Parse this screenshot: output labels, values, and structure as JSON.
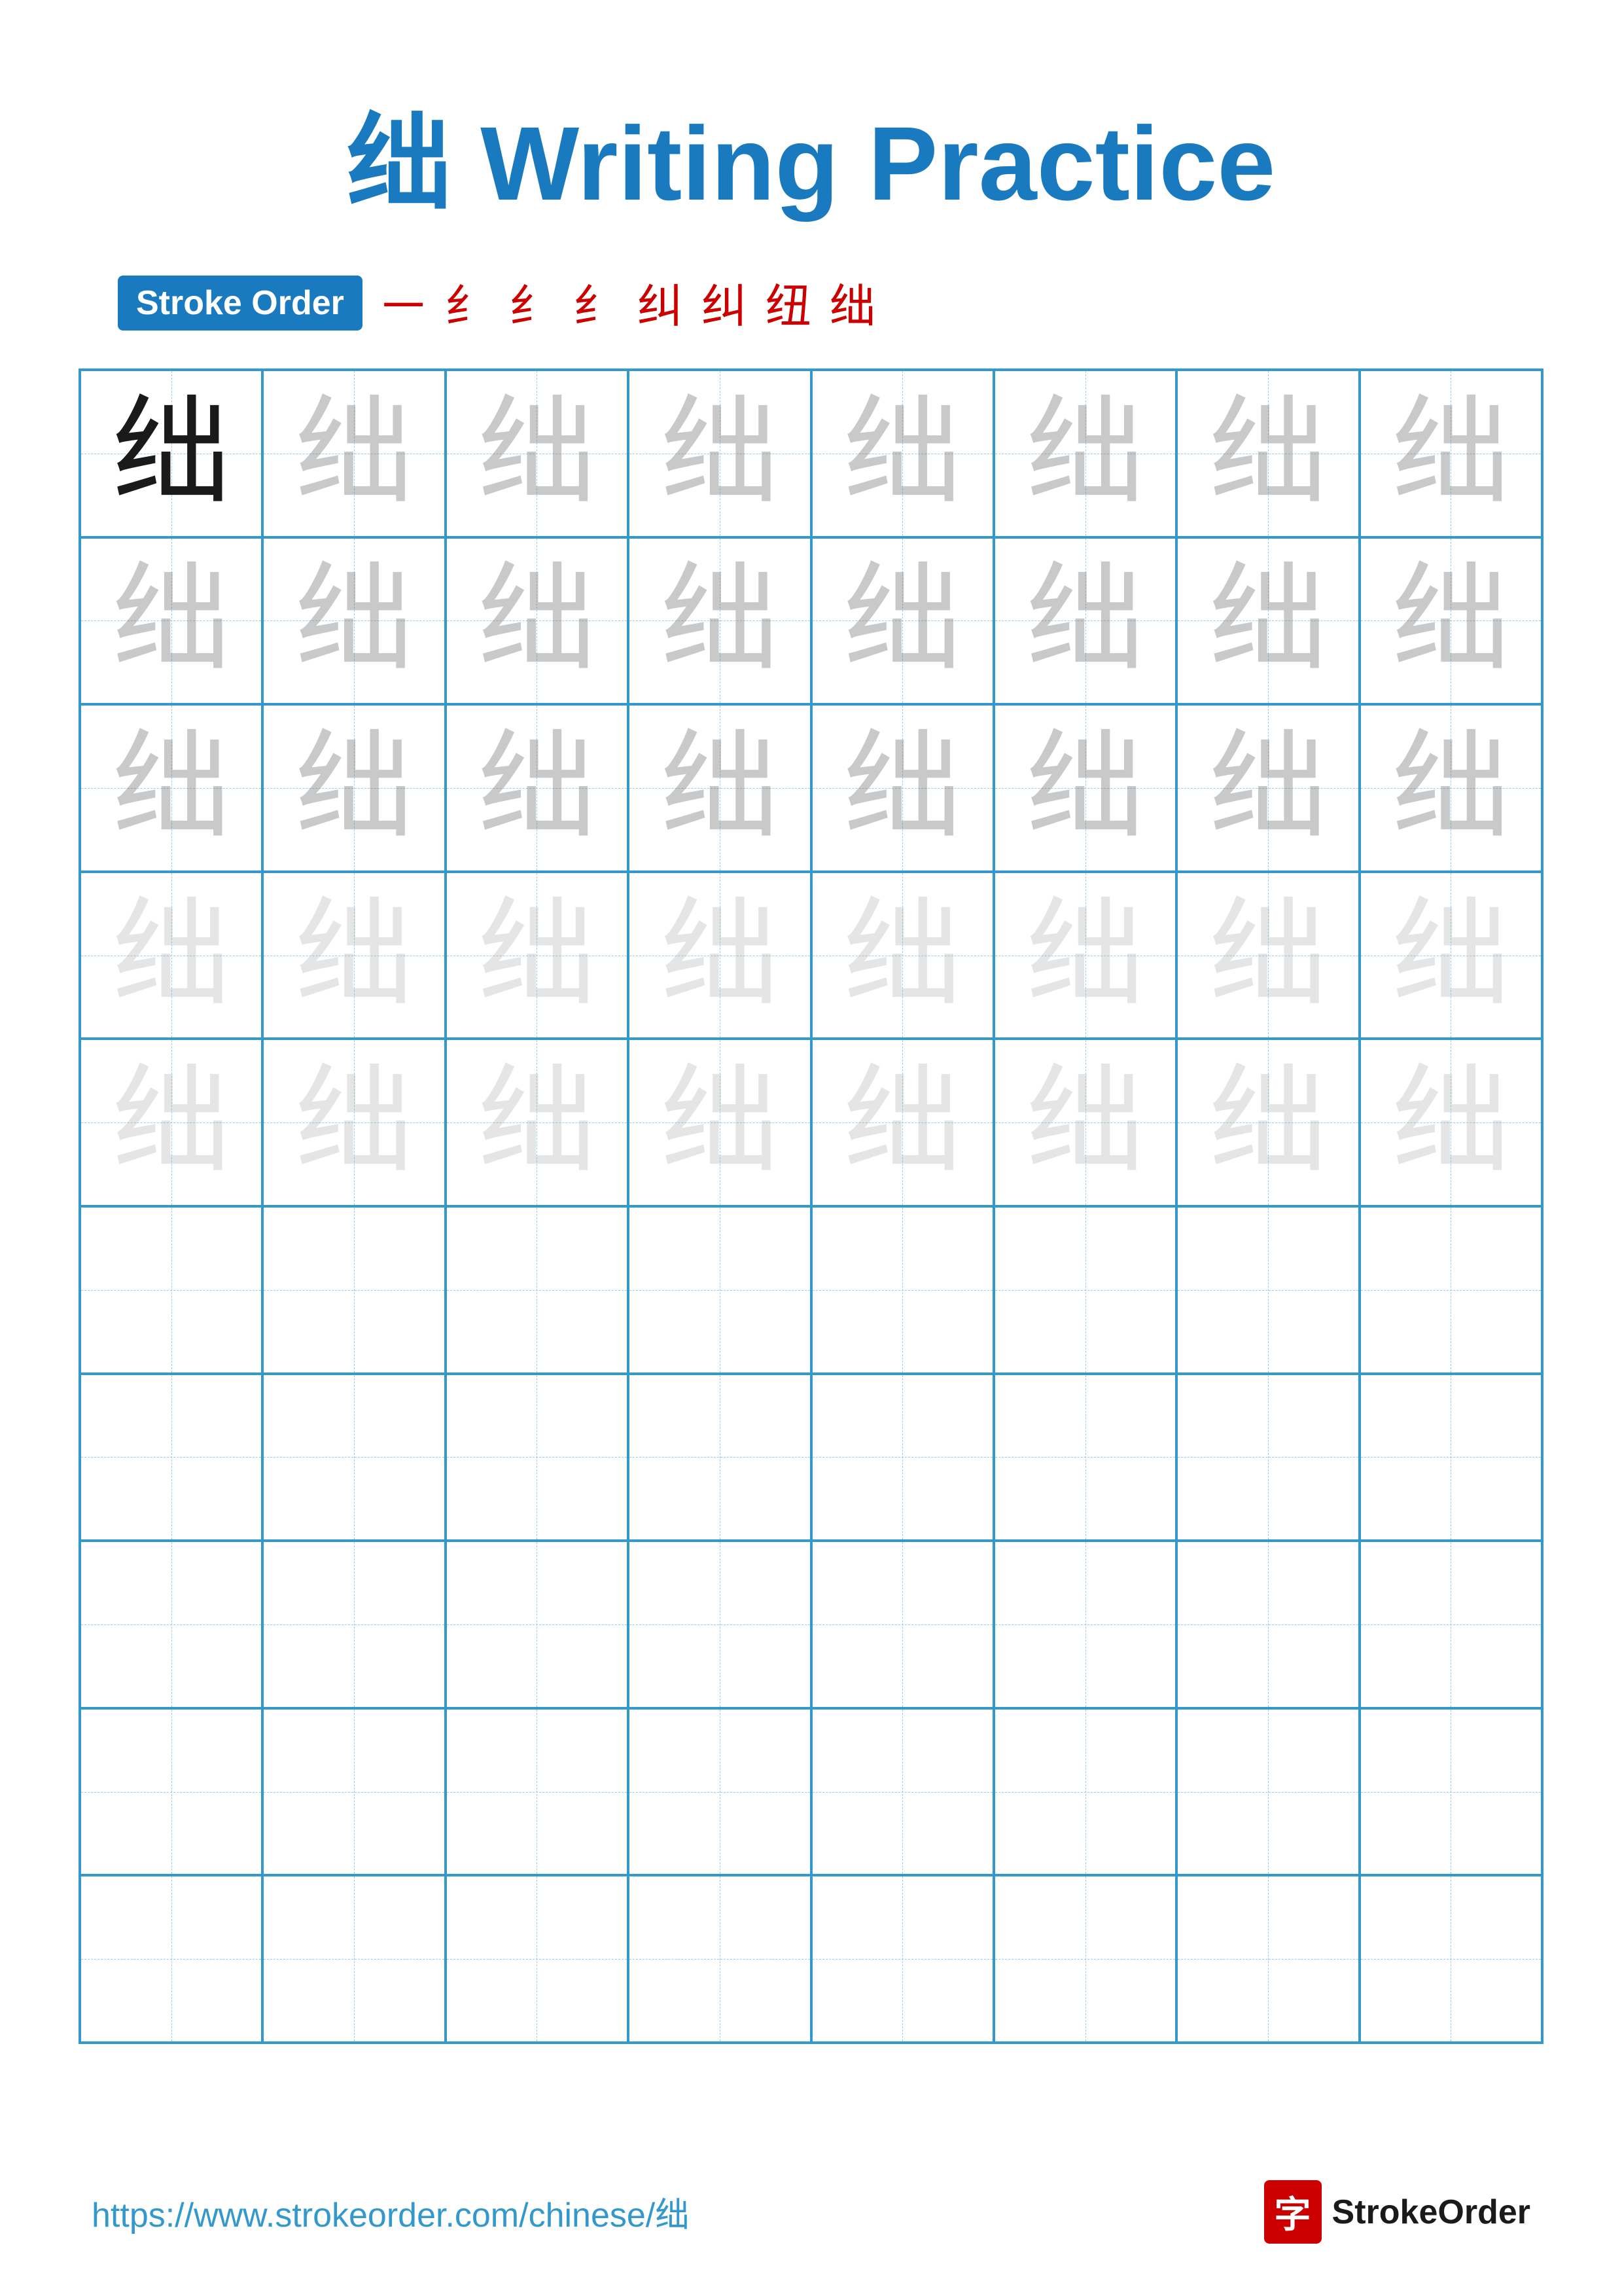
{
  "title": {
    "char": "绌",
    "suffix": " Writing Practice"
  },
  "stroke_order": {
    "badge_label": "Stroke Order",
    "steps": [
      "㇐",
      "纟",
      "纟",
      "纟",
      "纠",
      "纠",
      "纽",
      "绌"
    ]
  },
  "grid": {
    "cols": 8,
    "rows": 10,
    "char": "绌",
    "row_types": [
      "dark",
      "light1",
      "light1",
      "light2",
      "light2",
      "empty",
      "empty",
      "empty",
      "empty",
      "empty"
    ]
  },
  "footer": {
    "url": "https://www.strokeorder.com/chinese/绌",
    "logo_char": "字",
    "logo_text": "StrokeOrder"
  }
}
